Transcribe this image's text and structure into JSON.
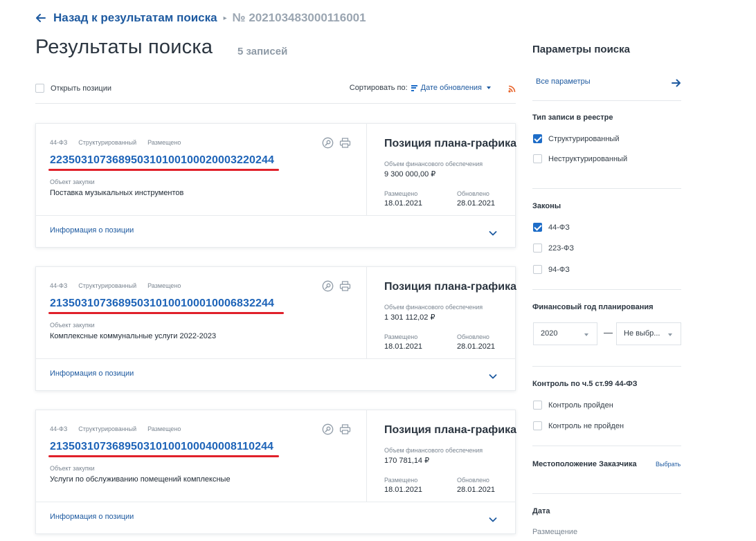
{
  "breadcrumb": {
    "back_label": "Назад к результатам поиска",
    "current": "№ 202103483000116001"
  },
  "header": {
    "title": "Результаты поиска",
    "count": "5 записей"
  },
  "toolbar": {
    "open_positions": "Открыть позиции",
    "sort_label": "Сортировать по:",
    "sort_value": "Дате обновления"
  },
  "results": [
    {
      "law": "44-ФЗ",
      "type": "Структурированный",
      "status": "Размещено",
      "number": "223503107368950310100100020003220244",
      "object_label": "Объект закупки",
      "object": "Поставка музыкальных инструментов",
      "side_title": "Позиция плана-графика",
      "fin_label": "Объем финансового обеспечения",
      "fin_value": "9 300 000,00 ₽",
      "placed_label": "Размещено",
      "placed": "18.01.2021",
      "updated_label": "Обновлено",
      "updated": "28.01.2021",
      "info_link": "Информация о позиции"
    },
    {
      "law": "44-ФЗ",
      "type": "Структурированный",
      "status": "Размещено",
      "number": "213503107368950310100100010006832244",
      "object_label": "Объект закупки",
      "object": "Комплексные коммунальные услуги 2022-2023",
      "side_title": "Позиция плана-графика",
      "fin_label": "Объем финансового обеспечения",
      "fin_value": "1 301 112,02 ₽",
      "placed_label": "Размещено",
      "placed": "18.01.2021",
      "updated_label": "Обновлено",
      "updated": "28.01.2021",
      "info_link": "Информация о позиции"
    },
    {
      "law": "44-ФЗ",
      "type": "Структурированный",
      "status": "Размещено",
      "number": "213503107368950310100100040008110244",
      "object_label": "Объект закупки",
      "object": "Услуги по обслуживанию помещений комплексные",
      "side_title": "Позиция плана-графика",
      "fin_label": "Объем финансового обеспечения",
      "fin_value": "170 781,14 ₽",
      "placed_label": "Размещено",
      "placed": "18.01.2021",
      "updated_label": "Обновлено",
      "updated": "28.01.2021",
      "info_link": "Информация о позиции"
    }
  ],
  "filters": {
    "title": "Параметры поиска",
    "all_params": "Все параметры",
    "record_type": {
      "title": "Тип записи в реестре",
      "options": [
        {
          "label": "Структурированный",
          "checked": true
        },
        {
          "label": "Неструктурированный",
          "checked": false
        }
      ]
    },
    "laws": {
      "title": "Законы",
      "options": [
        {
          "label": "44-ФЗ",
          "checked": true
        },
        {
          "label": "223-ФЗ",
          "checked": false
        },
        {
          "label": "94-ФЗ",
          "checked": false
        }
      ]
    },
    "fin_year": {
      "title": "Финансовый год планирования",
      "from": "2020",
      "dash": "—",
      "to": "Не выбр..."
    },
    "control": {
      "title": "Контроль по ч.5 ст.99 44-ФЗ",
      "options": [
        {
          "label": "Контроль пройден",
          "checked": false
        },
        {
          "label": "Контроль не пройден",
          "checked": false
        }
      ]
    },
    "location": {
      "title": "Местоположение Заказчика",
      "choose": "Выбрать"
    },
    "date": {
      "title": "Дата",
      "sub": "Размещение"
    }
  },
  "colors": {
    "link": "#1e5aa0",
    "number": "#1e64b8",
    "accent_checkbox": "#1e6dc8",
    "highlight_underline": "#e0202a",
    "rss": "#e8632a"
  },
  "icons": [
    "back-arrow-icon",
    "sort-icon",
    "chevron-down-icon",
    "rss-icon",
    "search-document-icon",
    "print-icon",
    "arrow-right-icon",
    "checkmark-icon"
  ]
}
